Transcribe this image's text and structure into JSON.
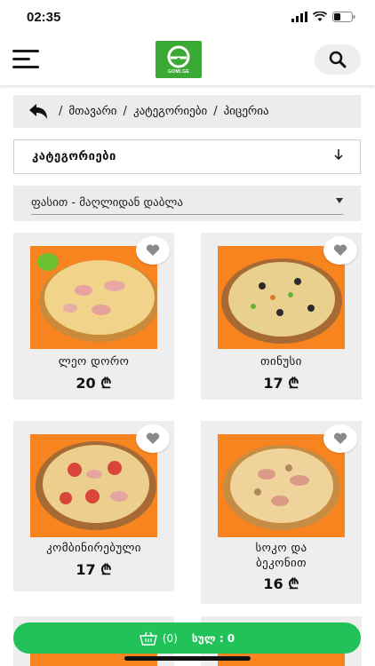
{
  "status_bar": {
    "time": "02:35"
  },
  "header": {
    "logo_text": "GOMI.GE"
  },
  "breadcrumb": {
    "items": [
      "მთავარი",
      "კატეგორიები",
      "პიცერია"
    ]
  },
  "category_dropdown": {
    "label": "კატეგორიები"
  },
  "sort": {
    "label": "ფასით - მაღლიდან დაბლა"
  },
  "products": [
    {
      "name": "ლეო დორო",
      "price": "20 ₾"
    },
    {
      "name": "თინუსი",
      "price": "17 ₾"
    },
    {
      "name": "კომბინირებული",
      "price": "17 ₾"
    },
    {
      "name": "სოკო და ბეკონით",
      "price": "16 ₾"
    }
  ],
  "cart": {
    "count": "(0)",
    "total": "სულ : 0"
  },
  "colors": {
    "brand_green": "#3aaa35",
    "cart_green": "#21c25a",
    "image_orange": "#f7841f"
  }
}
